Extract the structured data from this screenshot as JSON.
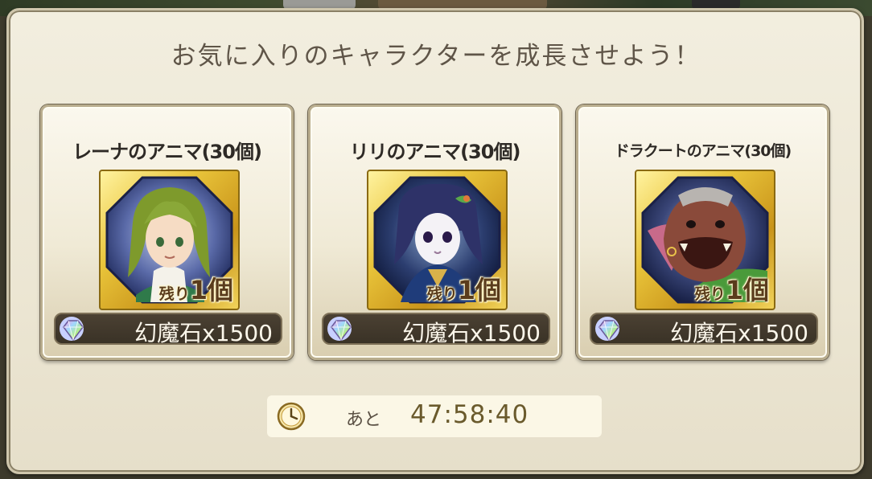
{
  "header": {
    "title": "お気に入りのキャラクターを成長させよう！"
  },
  "cards": [
    {
      "title": "レーナのアニマ(30個)",
      "remaining_prefix": "残り",
      "remaining_count": "1個",
      "price": "幻魔石x1500",
      "portrait_icon": "lena-portrait-icon",
      "currency_icon": "gem-icon"
    },
    {
      "title": "リリのアニマ(30個)",
      "remaining_prefix": "残り",
      "remaining_count": "1個",
      "price": "幻魔石x1500",
      "portrait_icon": "riri-portrait-icon",
      "currency_icon": "gem-icon"
    },
    {
      "title": "ドラクートのアニマ(30個)",
      "remaining_prefix": "残り",
      "remaining_count": "1個",
      "price": "幻魔石x1500",
      "portrait_icon": "dracute-portrait-icon",
      "currency_icon": "gem-icon"
    }
  ],
  "timer": {
    "label": "あと",
    "value": "47:58:40",
    "icon": "clock-icon"
  },
  "colors": {
    "panel_bg": "#ece6d3",
    "title_text": "#5f5548",
    "price_bar": "#3a3226",
    "gold_frame": "#e9c43a"
  }
}
